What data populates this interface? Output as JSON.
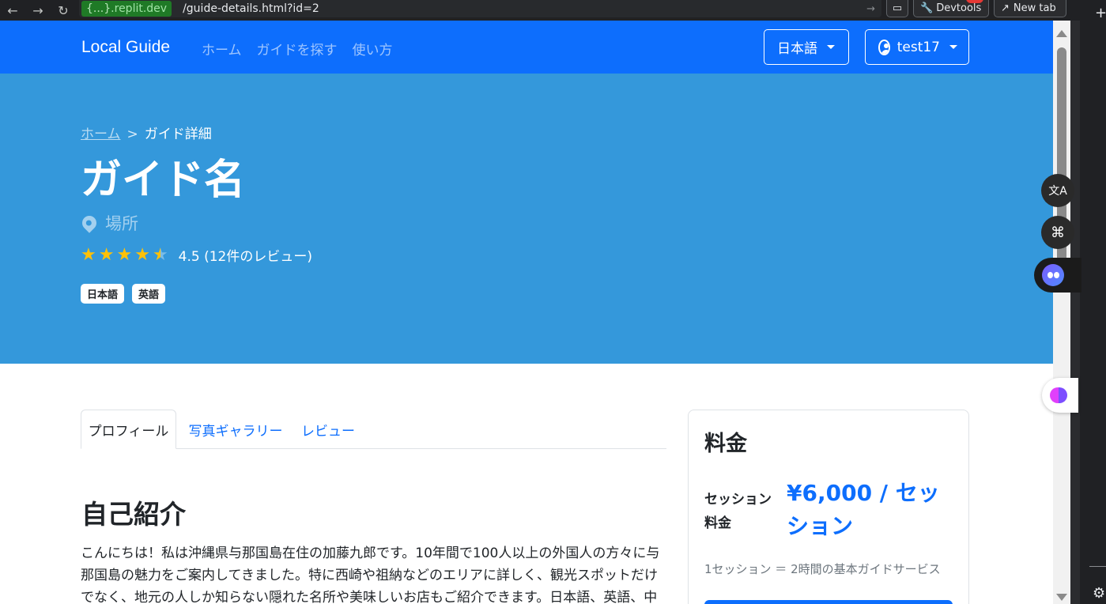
{
  "browser": {
    "url_domain_prefix": "{...}",
    "url_domain": ".replit.dev",
    "url_path": "/guide-details.html?id=2",
    "devtools_label": "Devtools",
    "new_tab_label": "New tab"
  },
  "navbar": {
    "brand": "Local Guide",
    "links": [
      "ホーム",
      "ガイドを探す",
      "使い方"
    ],
    "language_selected": "日本語",
    "user_name": "test17"
  },
  "hero": {
    "breadcrumb_home": "ホーム",
    "breadcrumb_separator": ">",
    "breadcrumb_current": "ガイド詳細",
    "title": "ガイド名",
    "location": "場所",
    "rating_value": 4.5,
    "rating_text": "4.5 (12件のレビュー)",
    "languages": [
      "日本語",
      "英語"
    ]
  },
  "tabs": [
    "プロフィール",
    "写真ギャラリー",
    "レビュー"
  ],
  "profile": {
    "section_title": "自己紹介",
    "intro_text": "こんにちは！私は沖縄県与那国島在住の加藤九郎です。10年間で100人以上の外国人の方々に与那国島の魅力をご案内してきました。特に西崎や祖納などのエリアに詳しく、観光スポットだけでなく、地元の人しか知らない隠れた名所や美味しいお店もご紹介できます。日本語、英語、中国語"
  },
  "pricing": {
    "title": "料金",
    "session_label": "セッション料金",
    "session_price": "¥6,000 / セッション",
    "note": "1セッション ＝ 2時間の基本ガイドサービス"
  },
  "icons": {
    "translate": "translate-icon",
    "apps": "command-icon",
    "assistant": "assistant-face-icon",
    "brain": "brain-icon"
  }
}
